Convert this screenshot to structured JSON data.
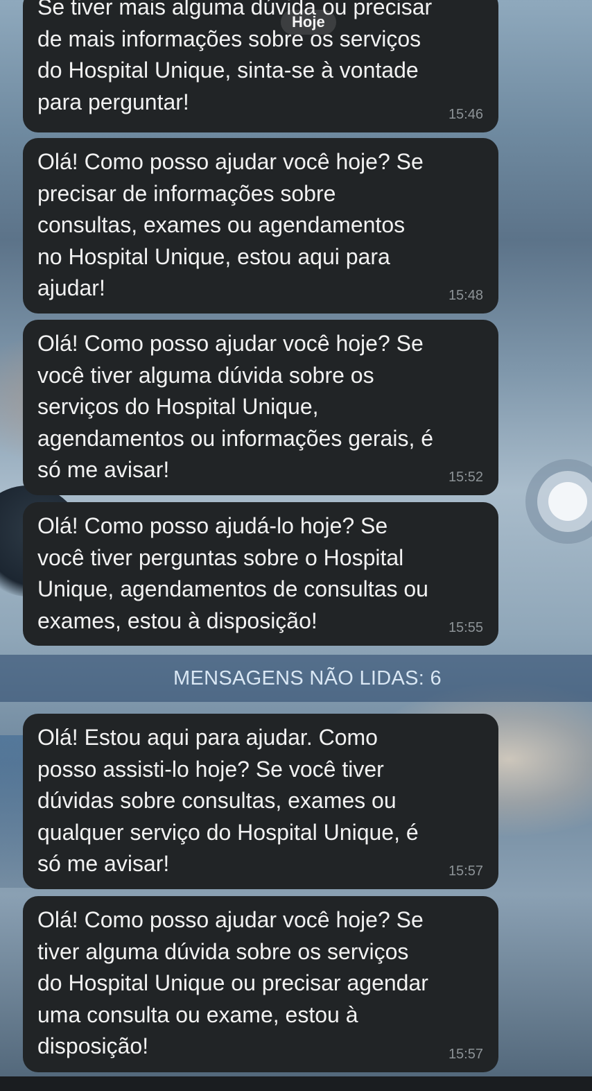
{
  "chat": {
    "day_label": "Hoje",
    "unread_label": "MENSAGENS NÃO LIDAS: 6",
    "messages": [
      {
        "text": "Se tiver mais alguma dúvida ou precisar\nde mais informações sobre os serviços\ndo Hospital Unique, sinta-se à vontade\npara perguntar!",
        "time": "15:46"
      },
      {
        "text": "Olá! Como posso ajudar você hoje? Se\nprecisar de informações sobre\nconsultas, exames ou agendamentos\nno Hospital Unique, estou aqui para\najudar!",
        "time": "15:48"
      },
      {
        "text": "Olá! Como posso ajudar você hoje? Se\nvocê tiver alguma dúvida sobre os\nserviços do Hospital Unique,\nagendamentos ou informações gerais, é\nsó me avisar!",
        "time": "15:52"
      },
      {
        "text": "Olá! Como posso ajudá-lo hoje? Se\nvocê tiver perguntas sobre o Hospital\nUnique, agendamentos de consultas ou\nexames, estou à disposição!",
        "time": "15:55"
      },
      {
        "text": "Olá! Estou aqui para ajudar. Como\nposso assisti-lo hoje? Se você tiver\ndúvidas sobre consultas, exames ou\nqualquer serviço do Hospital Unique, é\nsó me avisar!",
        "time": "15:57"
      },
      {
        "text": "Olá! Como posso ajudar você hoje? Se\ntiver alguma dúvida sobre os serviços\ndo Hospital Unique ou precisar agendar\numa consulta ou exame, estou à\ndisposição!",
        "time": "15:57"
      }
    ]
  },
  "colors": {
    "bubble": "#212426",
    "text": "#f2f2f2",
    "time": "#8d9397",
    "unread_band_text": "#d9e7f4"
  },
  "icons": {
    "scroll_to_bottom": "scroll-ring-icon"
  }
}
